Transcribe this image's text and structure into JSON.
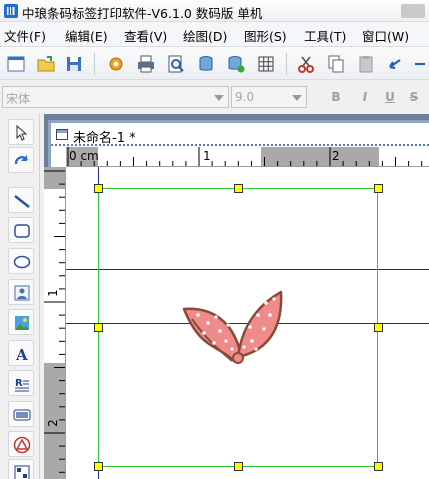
{
  "window": {
    "title": "中琅条码标签打印软件-V6.1.0 数码版 单机"
  },
  "menu": [
    "文件(F)",
    "编辑(E)",
    "查看(V)",
    "绘图(D)",
    "图形(S)",
    "工具(T)",
    "窗口(W)"
  ],
  "fontbar": {
    "font_name": "宋体",
    "font_size": "9.0",
    "bold": "B",
    "italic": "I",
    "underline": "U",
    "strike": "S"
  },
  "document": {
    "tab_title": "未命名-1 *"
  },
  "ruler": {
    "h_labels": [
      "0 cm",
      "1",
      "2"
    ],
    "v_labels": [
      "1",
      "2"
    ]
  },
  "colors": {
    "selection": "#2ec92e",
    "handle": "#ffff00",
    "leaf_fill": "#f08b8b",
    "leaf_outline": "#8a4a3a",
    "workspace": "#6d7e96"
  }
}
